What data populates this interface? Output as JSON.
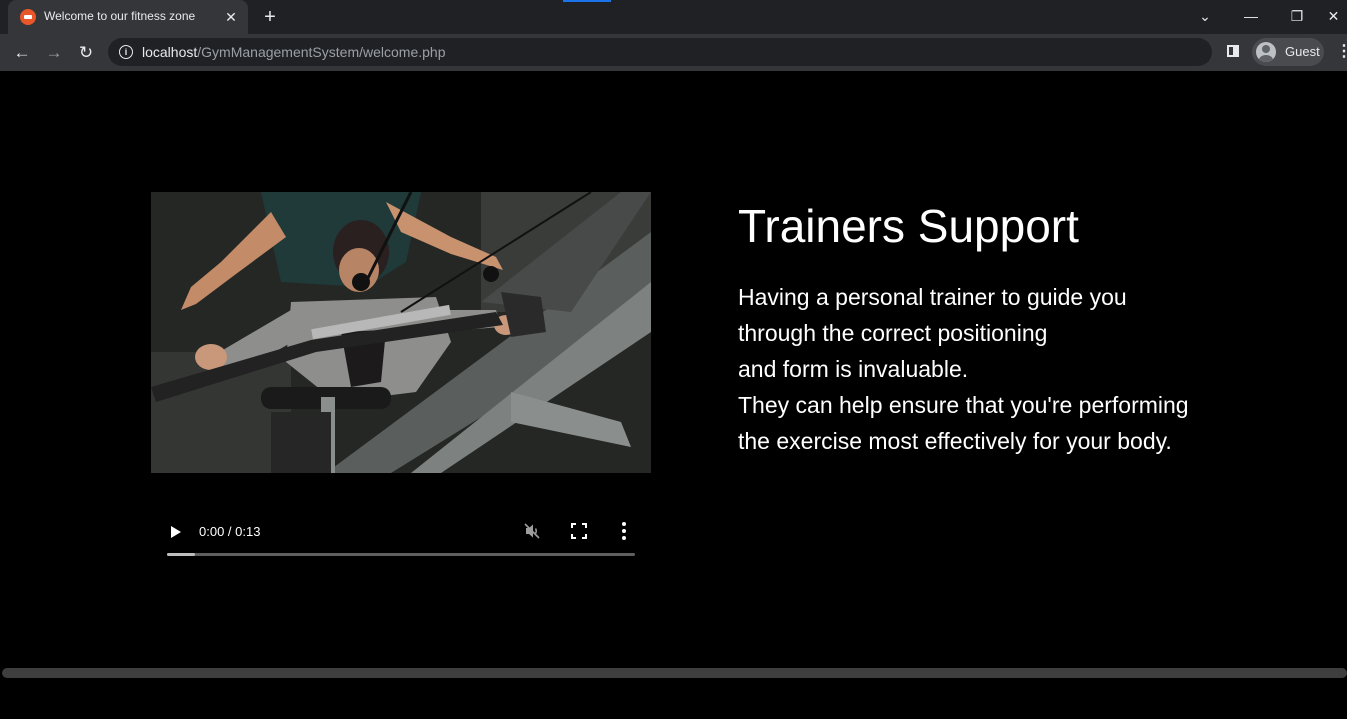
{
  "browser": {
    "tab": {
      "title": "Welcome to our fitness zone",
      "close_glyph": "✕"
    },
    "new_tab_glyph": "+",
    "window_controls": {
      "tab_search": "⌄",
      "minimize": "—",
      "restore": "❐",
      "close": "✕"
    },
    "nav": {
      "back": "←",
      "forward": "→",
      "reload": "↻"
    },
    "address": {
      "host": "localhost",
      "path": "/GymManagementSystem/welcome.php",
      "info_glyph": "i"
    },
    "profile_label": "Guest",
    "menu_glyph": "⋮"
  },
  "page": {
    "video": {
      "time": "0:00 / 0:13",
      "buffered_fraction": 0.06,
      "muted": true
    },
    "heading": "Trainers Support",
    "paragraph_lines": [
      "Having a personal trainer to guide you",
      "through the correct positioning",
      "and form is invaluable.",
      "They can help ensure that you're performing",
      "the exercise most effectively for your body."
    ]
  },
  "colors": {
    "chrome_dark": "#202124",
    "chrome_toolbar": "#35363a",
    "page_background": "#000000",
    "text": "#ffffff",
    "favicon": "#e8572a"
  }
}
